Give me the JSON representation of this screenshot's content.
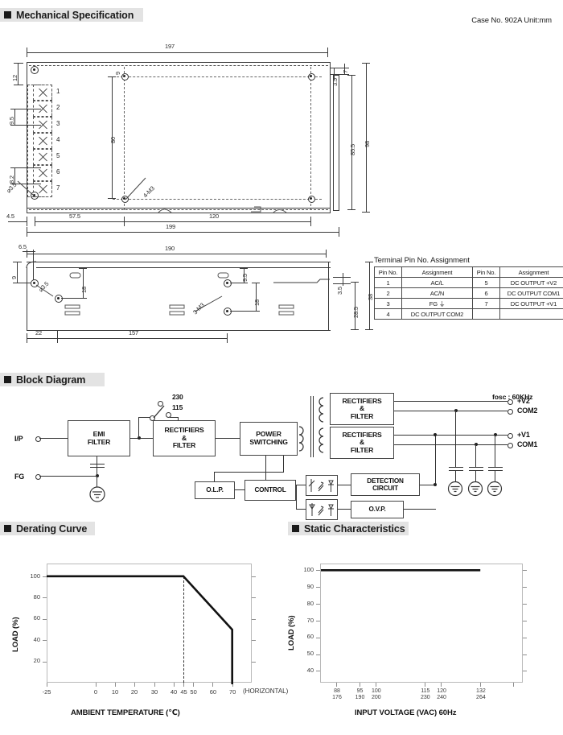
{
  "sections": {
    "mechanical": "Mechanical Specification",
    "block": "Block Diagram",
    "derating": "Derating Curve",
    "static": "Static Characteristics"
  },
  "case_info": "Case No. 902A    Unit:mm",
  "mechanical": {
    "top_view": {
      "dims": {
        "overall_width": "197",
        "overall_length_bottom": "199",
        "height_left_top": "12",
        "pin_spacing_a": "9.5",
        "pin_spacing_b": "8.2",
        "hole_dia": "⌀3.5",
        "mount_center_v": "80",
        "mount_label": "4-M3",
        "offset_left": "4.5",
        "mount_x1": "57.5",
        "mount_x2": "120",
        "edge_small_1": "9",
        "edge_small_2": "7",
        "edge_small_3": "3.5",
        "inner_height": "85.5",
        "outer_height": "98"
      },
      "pin_numbers": [
        "1",
        "2",
        "3",
        "4",
        "5",
        "6",
        "7"
      ]
    },
    "side_view": {
      "dims": {
        "len_190": "190",
        "len_157": "157",
        "len_22": "22",
        "offset_6_5": "6.5",
        "edge_9": "9",
        "hole_dia": "⌀3.5",
        "mid_18a": "18",
        "mid_18b": "18",
        "mid_9_5": "9.5",
        "mount_label": "3-M3",
        "small_3_5": "3.5",
        "dim_28_5": "28.5",
        "dim_38": "38"
      }
    },
    "pin_table": {
      "title": "Terminal Pin No. Assignment",
      "headers": [
        "Pin No.",
        "Assignment",
        "Pin No.",
        "Assignment"
      ],
      "rows": [
        [
          "1",
          "AC/L",
          "5",
          "DC OUTPUT +V2"
        ],
        [
          "2",
          "AC/N",
          "6",
          "DC OUTPUT COM1"
        ],
        [
          "3",
          "FG ⏚",
          "7",
          "DC OUTPUT +V1"
        ],
        [
          "4",
          "DC OUTPUT COM2",
          "",
          ""
        ]
      ]
    }
  },
  "block_diagram": {
    "fosc": "fosc : 60KHz",
    "inputs": [
      {
        "label": "I/P"
      },
      {
        "label": "FG"
      }
    ],
    "switch_taps": [
      "230",
      "115"
    ],
    "blocks": [
      {
        "id": "emi",
        "lines": [
          "EMI",
          "FILTER"
        ]
      },
      {
        "id": "rect_in",
        "lines": [
          "RECTIFIERS",
          "&",
          "FILTER"
        ]
      },
      {
        "id": "power",
        "lines": [
          "POWER",
          "SWITCHING"
        ]
      },
      {
        "id": "rect_out2",
        "lines": [
          "RECTIFIERS",
          "&",
          "FILTER"
        ]
      },
      {
        "id": "rect_out1",
        "lines": [
          "RECTIFIERS",
          "&",
          "FILTER"
        ]
      },
      {
        "id": "olp",
        "lines": [
          "O.L.P."
        ]
      },
      {
        "id": "control",
        "lines": [
          "CONTROL"
        ]
      },
      {
        "id": "detection",
        "lines": [
          "DETECTION",
          "CIRCUIT"
        ]
      },
      {
        "id": "ovp",
        "lines": [
          "O.V.P."
        ]
      }
    ],
    "outputs": [
      "+V2",
      "COM2",
      "+V1",
      "COM1"
    ]
  },
  "chart_data": [
    {
      "type": "line",
      "id": "derating-curve",
      "title": "Derating Curve",
      "xlabel": "AMBIENT TEMPERATURE (℃)",
      "ylabel": "LOAD (%)",
      "note": "(HORIZONTAL)",
      "xlim": [
        -25,
        80
      ],
      "ylim": [
        0,
        112
      ],
      "xticks": [
        -25,
        0,
        10,
        20,
        30,
        40,
        45,
        50,
        60,
        70
      ],
      "xticklabels": [
        "-25",
        "0",
        "10",
        "20",
        "30",
        "40",
        "45",
        "50",
        "60",
        "70"
      ],
      "yticks": [
        20,
        40,
        60,
        80,
        100
      ],
      "yticklabels": [
        "20",
        "40",
        "60",
        "80",
        "100"
      ],
      "grid": false,
      "legend": "none",
      "marker_line_x": 45,
      "series": [
        {
          "name": "Load derating",
          "points": [
            {
              "x": -25,
              "y": 100
            },
            {
              "x": 45,
              "y": 100
            },
            {
              "x": 70,
              "y": 50
            },
            {
              "x": 70,
              "y": 0
            }
          ]
        }
      ]
    },
    {
      "type": "line",
      "id": "static-characteristics",
      "title": "Static Characteristics",
      "xlabel": "INPUT VOLTAGE (VAC) 60Hz",
      "ylabel": "LOAD (%)",
      "xlim": [
        83,
        145
      ],
      "ylim": [
        33,
        104
      ],
      "xticks": [
        88,
        95,
        100,
        115,
        120,
        132
      ],
      "xticklabels_top": [
        "88",
        "95",
        "100",
        "115",
        "120",
        "132"
      ],
      "xticklabels_bottom": [
        "176",
        "190",
        "200",
        "230",
        "240",
        "264"
      ],
      "yticks": [
        40,
        50,
        60,
        70,
        80,
        90,
        100
      ],
      "yticklabels": [
        "40",
        "50",
        "60",
        "70",
        "80",
        "90",
        "100"
      ],
      "grid": false,
      "legend": "none",
      "series": [
        {
          "name": "Load",
          "points": [
            {
              "x": 88,
              "y": 100
            },
            {
              "x": 132,
              "y": 100
            }
          ]
        }
      ]
    }
  ]
}
